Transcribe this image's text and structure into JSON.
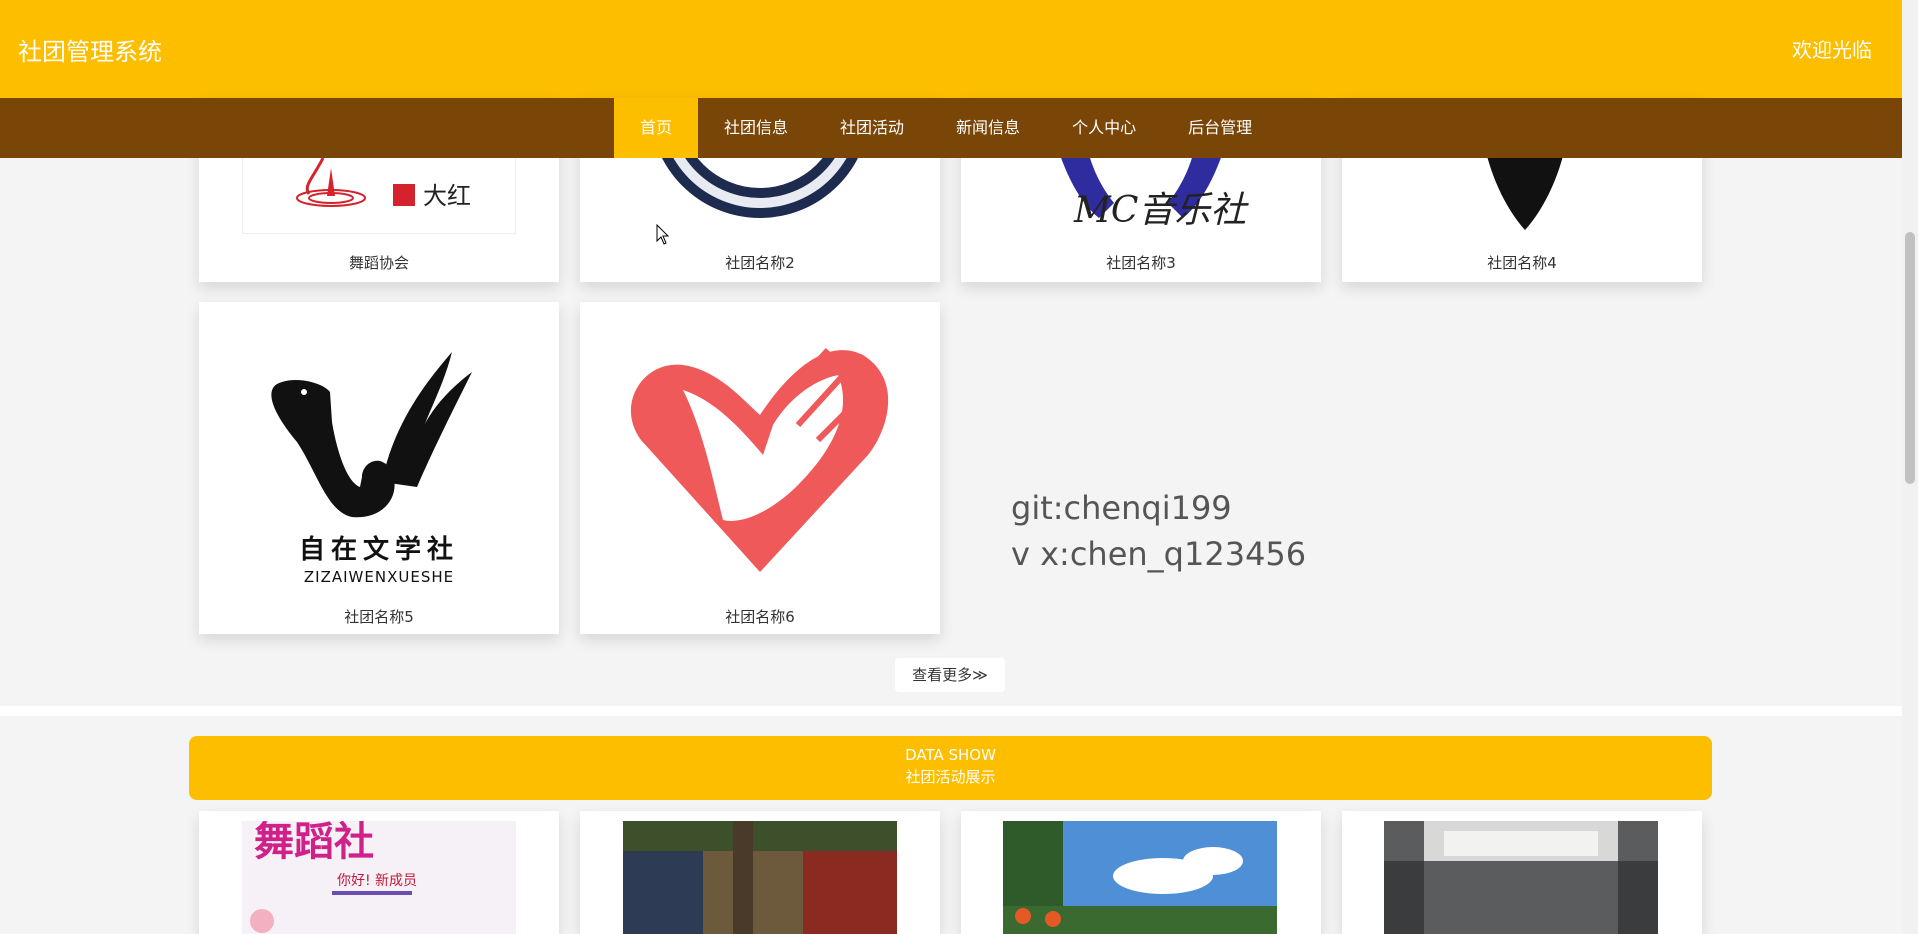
{
  "header": {
    "title": "社团管理系统",
    "welcome": "欢迎光临"
  },
  "nav": {
    "items": [
      "首页",
      "社团信息",
      "社团活动",
      "新闻信息",
      "个人中心",
      "后台管理"
    ],
    "active_index": 0
  },
  "clubs": {
    "cards": [
      {
        "label": "舞蹈协会",
        "image_text": "大红"
      },
      {
        "label": "社团名称2"
      },
      {
        "label": "社团名称3",
        "image_text": "MC音乐社"
      },
      {
        "label": "社团名称4"
      },
      {
        "label": "社团名称5",
        "image_text": "自在文学社",
        "image_subtext": "ZIZAIWENXUESHE"
      },
      {
        "label": "社团名称6"
      }
    ],
    "more_button": "查看更多≫"
  },
  "watermark": {
    "line1": "git:chenqi199",
    "line2": "v x:chen_q123456"
  },
  "data_show": {
    "title_en": "DATA SHOW",
    "title_cn": "社团活动展示",
    "first_poster_title": "舞蹈社",
    "first_poster_sub": "你好! 新成员"
  },
  "colors": {
    "accent": "#fdbe00",
    "nav_bg": "#7a4607",
    "page_bg": "#f4f4f4",
    "heart_red": "#f0595a"
  }
}
